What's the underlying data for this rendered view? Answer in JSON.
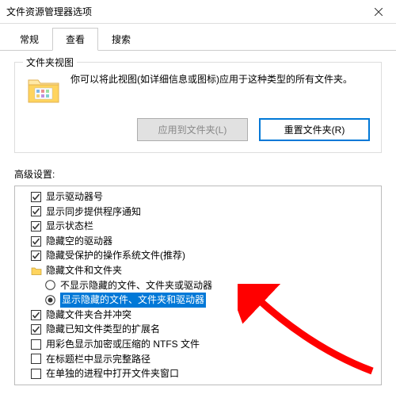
{
  "window": {
    "title": "文件资源管理器选项"
  },
  "tabs": {
    "general": "常规",
    "view": "查看",
    "search": "搜索"
  },
  "folderView": {
    "group_label": "文件夹视图",
    "description": "你可以将此视图(如详细信息或图标)应用于这种类型的所有文件夹。",
    "apply_btn": "应用到文件夹(L)",
    "reset_btn": "重置文件夹(R)"
  },
  "advanced": {
    "label": "高级设置:",
    "items": [
      {
        "type": "checkbox",
        "checked": true,
        "indent": 1,
        "text": "显示驱动器号"
      },
      {
        "type": "checkbox",
        "checked": true,
        "indent": 1,
        "text": "显示同步提供程序通知"
      },
      {
        "type": "checkbox",
        "checked": true,
        "indent": 1,
        "text": "显示状态栏"
      },
      {
        "type": "checkbox",
        "checked": true,
        "indent": 1,
        "text": "隐藏空的驱动器"
      },
      {
        "type": "checkbox",
        "checked": true,
        "indent": 1,
        "text": "隐藏受保护的操作系统文件(推荐)"
      },
      {
        "type": "folder",
        "checked": false,
        "indent": 1,
        "text": "隐藏文件和文件夹"
      },
      {
        "type": "radio",
        "checked": false,
        "indent": 2,
        "text": "不显示隐藏的文件、文件夹或驱动器"
      },
      {
        "type": "radio",
        "checked": true,
        "indent": 2,
        "text": "显示隐藏的文件、文件夹和驱动器",
        "selected": true
      },
      {
        "type": "checkbox",
        "checked": true,
        "indent": 1,
        "text": "隐藏文件夹合并冲突"
      },
      {
        "type": "checkbox",
        "checked": true,
        "indent": 1,
        "text": "隐藏已知文件类型的扩展名"
      },
      {
        "type": "checkbox",
        "checked": false,
        "indent": 1,
        "text": "用彩色显示加密或压缩的 NTFS 文件"
      },
      {
        "type": "checkbox",
        "checked": false,
        "indent": 1,
        "text": "在标题栏中显示完整路径"
      },
      {
        "type": "checkbox",
        "checked": false,
        "indent": 1,
        "text": "在单独的进程中打开文件夹窗口"
      }
    ]
  }
}
